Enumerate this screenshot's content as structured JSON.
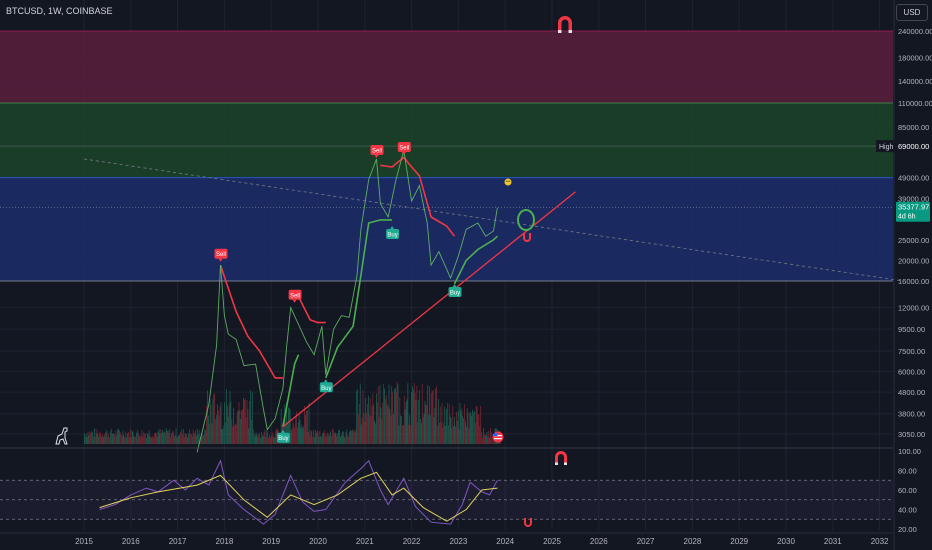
{
  "header": {
    "symbol": "BTCUSD, 1W, COINBASE",
    "currency": "USD"
  },
  "colors": {
    "background": "#131722",
    "sell": "#f23645",
    "buy": "#22ab94",
    "supertrend_up": "#4caf50",
    "supertrend_down": "#f23645",
    "zone_top": "#5b1f3c",
    "zone_mid": "#1c4429",
    "zone_low": "#1c2e6b",
    "rsi": "#7e57c2",
    "rsi_ma": "#e0d35c",
    "trendline": "#f23645"
  },
  "chart_data": {
    "type": "line",
    "title": "BTCUSD, 1W, COINBASE",
    "y_scale": "log",
    "x_ticks": [
      "2015",
      "2016",
      "2017",
      "2018",
      "2019",
      "2020",
      "2021",
      "2022",
      "2023",
      "2024",
      "2025",
      "2026",
      "2027",
      "2028",
      "2029",
      "2030",
      "2031",
      "2032"
    ],
    "y_ticks": [
      "240000.00",
      "180000.00",
      "140000.00",
      "110000.00",
      "85000.00",
      "69000.00",
      "49000.00",
      "39000.00",
      "25000.00",
      "20000.00",
      "16000.00",
      "12000.00",
      "9500.00",
      "7500.00",
      "6000.00",
      "4800.00",
      "3800.00",
      "3050.00"
    ],
    "price_label": {
      "value": "35377.97",
      "countdown": "4d 6h"
    },
    "high_label": {
      "text": "High",
      "value": "69000.00"
    },
    "zones": [
      {
        "name": "upper",
        "from": 110000,
        "to": 240000
      },
      {
        "name": "middle",
        "from": 49000,
        "to": 110000
      },
      {
        "name": "lower",
        "from": 16000,
        "to": 49000
      }
    ],
    "price_series": [
      [
        "2017-06",
        2500
      ],
      [
        "2017-09",
        4200
      ],
      [
        "2017-11",
        8000
      ],
      [
        "2017-12",
        19000
      ],
      [
        "2018-01",
        11000
      ],
      [
        "2018-02",
        9000
      ],
      [
        "2018-04",
        8500
      ],
      [
        "2018-06",
        6400
      ],
      [
        "2018-09",
        6500
      ],
      [
        "2018-11",
        4000
      ],
      [
        "2018-12",
        3200
      ],
      [
        "2019-02",
        3600
      ],
      [
        "2019-04",
        5000
      ],
      [
        "2019-05",
        8000
      ],
      [
        "2019-06",
        12000
      ],
      [
        "2019-08",
        10000
      ],
      [
        "2019-10",
        8300
      ],
      [
        "2019-12",
        7200
      ],
      [
        "2020-02",
        9800
      ],
      [
        "2020-03",
        5800
      ],
      [
        "2020-05",
        9500
      ],
      [
        "2020-07",
        11000
      ],
      [
        "2020-09",
        10800
      ],
      [
        "2020-11",
        17000
      ],
      [
        "2020-12",
        28000
      ],
      [
        "2021-02",
        48000
      ],
      [
        "2021-04",
        60000
      ],
      [
        "2021-05",
        37000
      ],
      [
        "2021-07",
        32000
      ],
      [
        "2021-09",
        48000
      ],
      [
        "2021-11",
        66000
      ],
      [
        "2022-01",
        38000
      ],
      [
        "2022-03",
        45000
      ],
      [
        "2022-05",
        30000
      ],
      [
        "2022-06",
        19000
      ],
      [
        "2022-08",
        22000
      ],
      [
        "2022-11",
        16500
      ],
      [
        "2023-01",
        21000
      ],
      [
        "2023-03",
        28000
      ],
      [
        "2023-06",
        30000
      ],
      [
        "2023-08",
        26000
      ],
      [
        "2023-10",
        27500
      ],
      [
        "2023-11",
        35378
      ]
    ],
    "supertrend": [
      {
        "dir": "down",
        "points": [
          [
            "2017-12",
            19000
          ],
          [
            "2018-04",
            11500
          ],
          [
            "2018-07",
            8800
          ],
          [
            "2018-10",
            7500
          ],
          [
            "2019-02",
            5600
          ],
          [
            "2019-04",
            5600
          ]
        ]
      },
      {
        "dir": "up",
        "points": [
          [
            "2019-04",
            3300
          ],
          [
            "2019-07",
            6500
          ],
          [
            "2019-08",
            7200
          ]
        ]
      },
      {
        "dir": "down",
        "points": [
          [
            "2019-08",
            13500
          ],
          [
            "2019-11",
            10500
          ],
          [
            "2020-01",
            10200
          ],
          [
            "2020-03",
            10200
          ]
        ]
      },
      {
        "dir": "up",
        "points": [
          [
            "2020-03",
            5600
          ],
          [
            "2020-06",
            7800
          ],
          [
            "2020-10",
            9800
          ],
          [
            "2020-12",
            17000
          ],
          [
            "2021-02",
            30000
          ],
          [
            "2021-05",
            31000
          ],
          [
            "2021-08",
            31000
          ]
        ]
      },
      {
        "dir": "down",
        "points": [
          [
            "2021-05",
            56000
          ],
          [
            "2021-08",
            55000
          ],
          [
            "2021-11",
            61000
          ],
          [
            "2022-01",
            55000
          ],
          [
            "2022-03",
            50000
          ],
          [
            "2022-06",
            32000
          ],
          [
            "2022-10",
            29000
          ],
          [
            "2022-12",
            26000
          ]
        ]
      },
      {
        "dir": "up",
        "points": [
          [
            "2022-12",
            15500
          ],
          [
            "2023-03",
            20000
          ],
          [
            "2023-06",
            22500
          ],
          [
            "2023-10",
            25000
          ],
          [
            "2023-11",
            26000
          ]
        ]
      }
    ],
    "signals": [
      {
        "type": "Sell",
        "date": "2017-12",
        "price": 19500
      },
      {
        "type": "Buy",
        "date": "2019-04",
        "price": 3300
      },
      {
        "type": "Sell",
        "date": "2019-07",
        "price": 12500
      },
      {
        "type": "Buy",
        "date": "2020-03",
        "price": 5700
      },
      {
        "type": "Sell",
        "date": "2021-04",
        "price": 60000
      },
      {
        "type": "Buy",
        "date": "2021-08",
        "price": 30000
      },
      {
        "type": "Sell",
        "date": "2021-11",
        "price": 62000
      },
      {
        "type": "Buy",
        "date": "2022-12",
        "price": 16000
      }
    ],
    "trendline": [
      [
        "2019-04",
        3300
      ],
      [
        "2025-07",
        42000
      ]
    ],
    "dashed_line": [
      [
        "2015-01",
        60000
      ],
      [
        "2032-07",
        16000
      ]
    ],
    "rsi": {
      "y_ticks": [
        "100.00",
        "80.00",
        "60.00",
        "40.00",
        "20.00"
      ],
      "levels": [
        70,
        50,
        30
      ],
      "series": [
        [
          "2015-05",
          40
        ],
        [
          "2015-09",
          45
        ],
        [
          "2016-01",
          55
        ],
        [
          "2016-05",
          62
        ],
        [
          "2016-08",
          58
        ],
        [
          "2016-12",
          70
        ],
        [
          "2017-03",
          60
        ],
        [
          "2017-06",
          72
        ],
        [
          "2017-09",
          65
        ],
        [
          "2017-12",
          90
        ],
        [
          "2018-02",
          55
        ],
        [
          "2018-06",
          40
        ],
        [
          "2018-11",
          25
        ],
        [
          "2019-02",
          35
        ],
        [
          "2019-06",
          75
        ],
        [
          "2019-09",
          48
        ],
        [
          "2019-12",
          38
        ],
        [
          "2020-03",
          40
        ],
        [
          "2020-08",
          68
        ],
        [
          "2020-12",
          82
        ],
        [
          "2021-02",
          90
        ],
        [
          "2021-05",
          60
        ],
        [
          "2021-07",
          45
        ],
        [
          "2021-11",
          72
        ],
        [
          "2022-02",
          43
        ],
        [
          "2022-06",
          27
        ],
        [
          "2022-11",
          25
        ],
        [
          "2023-02",
          45
        ],
        [
          "2023-04",
          68
        ],
        [
          "2023-07",
          58
        ],
        [
          "2023-09",
          55
        ],
        [
          "2023-11",
          70
        ]
      ],
      "ma": [
        [
          "2015-05",
          42
        ],
        [
          "2016-01",
          52
        ],
        [
          "2016-08",
          58
        ],
        [
          "2017-06",
          65
        ],
        [
          "2017-12",
          75
        ],
        [
          "2018-06",
          50
        ],
        [
          "2018-12",
          32
        ],
        [
          "2019-06",
          55
        ],
        [
          "2019-12",
          45
        ],
        [
          "2020-06",
          55
        ],
        [
          "2020-12",
          72
        ],
        [
          "2021-04",
          78
        ],
        [
          "2021-08",
          55
        ],
        [
          "2021-11",
          62
        ],
        [
          "2022-04",
          42
        ],
        [
          "2022-10",
          28
        ],
        [
          "2023-03",
          40
        ],
        [
          "2023-07",
          60
        ],
        [
          "2023-11",
          62
        ]
      ]
    }
  }
}
